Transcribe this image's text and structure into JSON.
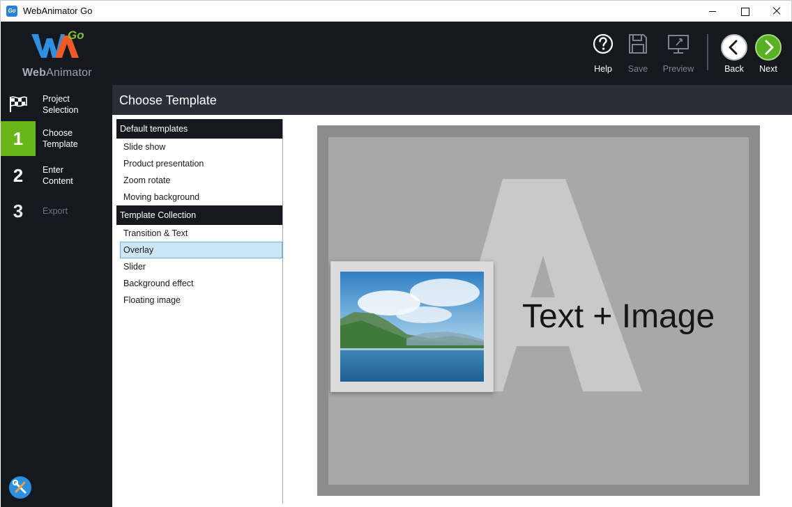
{
  "window": {
    "title": "WebAnimator Go",
    "icon_text": "Go",
    "controls": [
      "minimize",
      "maximize",
      "close"
    ]
  },
  "brand": {
    "logo_go": "Go",
    "logo_web": "Web",
    "logo_animator": "Animator",
    "colors": {
      "accent_green": "#67b519",
      "dark_bg": "#15191f",
      "header_bg": "#2a2f37",
      "selection": "#cce6f7"
    }
  },
  "sidebar": {
    "steps": [
      {
        "number": "",
        "label_line1": "Project",
        "label_line2": "Selection",
        "icon": "flag-icon",
        "state": "done"
      },
      {
        "number": "1",
        "label_line1": "Choose",
        "label_line2": "Template",
        "state": "active"
      },
      {
        "number": "2",
        "label_line1": "Enter",
        "label_line2": "Content",
        "state": "normal"
      },
      {
        "number": "3",
        "label_line1": "Export",
        "label_line2": "",
        "state": "disabled"
      }
    ],
    "footer_icon": "tools-icon"
  },
  "toolbar": {
    "help_label": "Help",
    "save_label": "Save",
    "preview_label": "Preview",
    "back_label": "Back",
    "next_label": "Next"
  },
  "header": {
    "title": "Choose Template"
  },
  "templates": {
    "groups": [
      {
        "title": "Default templates",
        "items": [
          "Slide show",
          "Product presentation",
          "Zoom rotate",
          "Moving background"
        ]
      },
      {
        "title": "Template Collection",
        "items": [
          "Transition & Text",
          "Overlay",
          "Slider",
          "Background effect",
          "Floating image"
        ]
      }
    ],
    "selected": "Overlay"
  },
  "preview": {
    "caption": "Text + Image",
    "letter": "A"
  }
}
